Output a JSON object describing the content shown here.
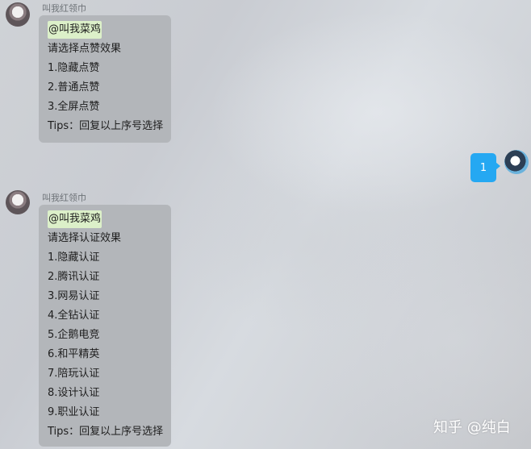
{
  "messages": [
    {
      "sender": "叫我红领巾",
      "mention": "@叫我菜鸡",
      "lines": [
        "请选择点赞效果",
        "1.隐藏点赞",
        "2.普通点赞",
        "3.全屏点赞",
        "Tips：回复以上序号选择"
      ]
    },
    {
      "sender": "叫我红领巾",
      "mention": "@叫我菜鸡",
      "lines": [
        "请选择认证效果",
        "1.隐藏认证",
        "2.腾讯认证",
        "3.网易认证",
        "4.全钻认证",
        "5.企鹅电竞",
        "6.和平精英",
        "7.陪玩认证",
        "8.设计认证",
        "9.职业认证",
        "Tips：回复以上序号选择"
      ]
    }
  ],
  "outgoing": {
    "text": "1"
  },
  "watermark": "知乎 @纯白",
  "colors": {
    "outgoing_bubble": "#25a8f2",
    "incoming_bubble": "#b3b6ba",
    "mention_highlight": "#dcf0c9"
  }
}
